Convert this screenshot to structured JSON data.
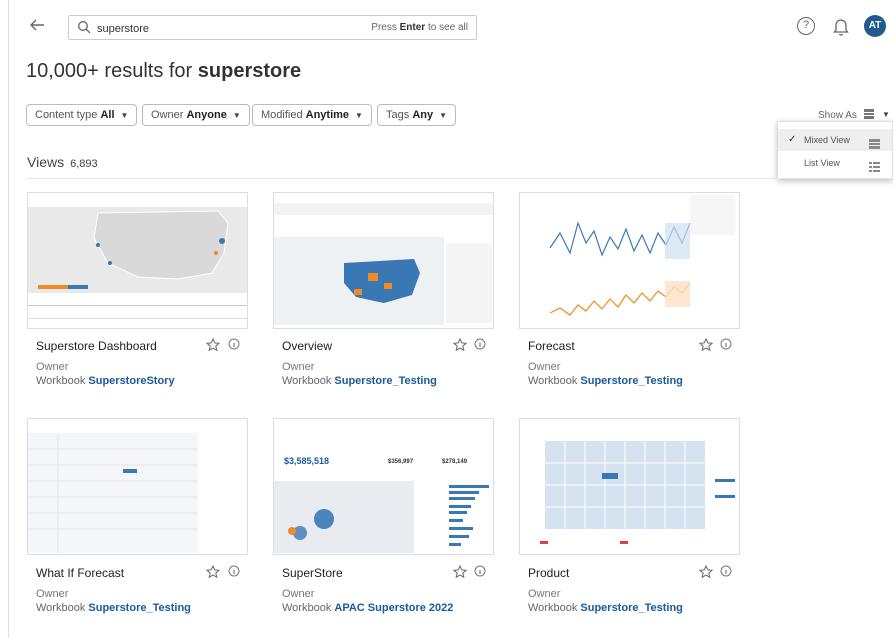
{
  "search": {
    "value": "superstore",
    "hint_prefix": "Press",
    "hint_key": "Enter",
    "hint_suffix": "to see all"
  },
  "user": {
    "initials": "AT",
    "avatar_color": "#1f5b8e"
  },
  "results": {
    "prefix": "10,000+ results for",
    "term": "superstore"
  },
  "filters": [
    {
      "label": "Content type",
      "value": "All"
    },
    {
      "label": "Owner",
      "value": "Anyone"
    },
    {
      "label": "Modified",
      "value": "Anytime"
    },
    {
      "label": "Tags",
      "value": "Any"
    }
  ],
  "show_as": {
    "label": "Show As",
    "options": [
      {
        "label": "Mixed View",
        "selected": true
      },
      {
        "label": "List View",
        "selected": false
      }
    ]
  },
  "section": {
    "title": "Views",
    "count": "6,893"
  },
  "cards": [
    {
      "title": "Superstore Dashboard",
      "owner": "Owner",
      "workbook_label": "Workbook",
      "workbook": "SuperstoreStory"
    },
    {
      "title": "Overview",
      "owner": "Owner",
      "workbook_label": "Workbook",
      "workbook": "Superstore_Testing"
    },
    {
      "title": "Forecast",
      "owner": "Owner",
      "workbook_label": "Workbook",
      "workbook": "Superstore_Testing"
    },
    {
      "title": "What If Forecast",
      "owner": "Owner",
      "workbook_label": "Workbook",
      "workbook": "Superstore_Testing"
    },
    {
      "title": "SuperStore",
      "owner": "Owner",
      "workbook_label": "Workbook",
      "workbook": "APAC Superstore 2022"
    },
    {
      "title": "Product",
      "owner": "Owner",
      "workbook_label": "Workbook",
      "workbook": "Superstore_Testing"
    }
  ],
  "thumb_text": {
    "superstore_kpi": "$3,585,518",
    "superstore_kpi2": "$356,997",
    "superstore_kpi3": "$278,149"
  },
  "colors": {
    "accent": "#1a5a9c",
    "map_blue": "#3a78b5",
    "map_orange": "#f08a24"
  }
}
